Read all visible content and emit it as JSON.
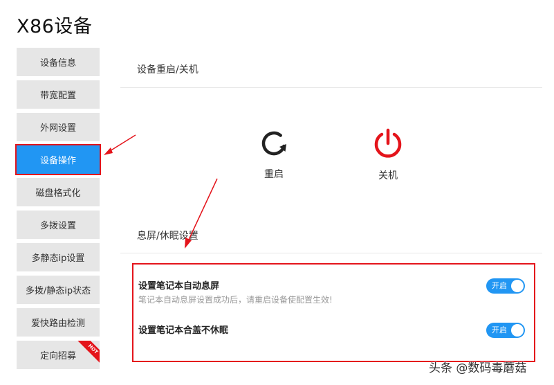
{
  "page_title": "X86设备",
  "sidebar": {
    "items": [
      {
        "label": "设备信息"
      },
      {
        "label": "带宽配置"
      },
      {
        "label": "外网设置"
      },
      {
        "label": "设备操作",
        "active": true
      },
      {
        "label": "磁盘格式化"
      },
      {
        "label": "多拨设置"
      },
      {
        "label": "多静态ip设置"
      },
      {
        "label": "多拨/静态ip状态"
      },
      {
        "label": "爱快路由检测"
      },
      {
        "label": "定向招募",
        "badge": "HOT"
      }
    ]
  },
  "reboot_section": {
    "title": "设备重启/关机",
    "restart": {
      "label": "重启",
      "icon": "restart-icon"
    },
    "shutdown": {
      "label": "关机",
      "icon": "power-icon"
    }
  },
  "screen_section": {
    "title": "息屏/休眠设置",
    "settings": [
      {
        "label": "设置笔记本自动息屏",
        "hint": "笔记本自动息屏设置成功后，请重启设备使配置生效!",
        "toggle": "开启",
        "on": true
      },
      {
        "label": "设置笔记本合盖不休眠",
        "toggle": "开启",
        "on": true
      }
    ]
  },
  "watermark": "头条 @数码毒蘑菇",
  "colors": {
    "accent": "#2196f3",
    "highlight": "#e4141b",
    "power": "#e4141b",
    "sidebar_bg": "#e6e6e6"
  }
}
